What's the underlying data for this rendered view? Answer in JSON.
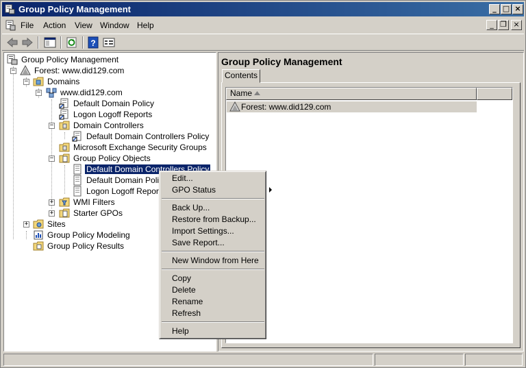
{
  "window": {
    "title": "Group Policy Management"
  },
  "menubar": {
    "items": [
      "File",
      "Action",
      "View",
      "Window",
      "Help"
    ]
  },
  "toolbar": {
    "buttons": [
      "back-icon",
      "forward-icon",
      "show-hide-tree-icon",
      "refresh-icon",
      "help-icon",
      "properties-icon"
    ]
  },
  "tree": {
    "root": "Group Policy Management",
    "forest": "Forest: www.did129.com",
    "domains": "Domains",
    "domain": "www.did129.com",
    "default_domain_policy": "Default Domain Policy",
    "logon_logoff_reports": "Logon Logoff Reports",
    "domain_controllers": "Domain Controllers",
    "default_dc_policy": "Default Domain Controllers Policy",
    "ms_exchange": "Microsoft Exchange Security Groups",
    "gpo": "Group Policy Objects",
    "gpo_dc_policy": "Default Domain Controllers Policy",
    "gpo_domain_policy": "Default Domain Policy",
    "gpo_logon_reports": "Logon Logoff Reports",
    "wmi_filters": "WMI Filters",
    "starter_gpos": "Starter GPOs",
    "sites": "Sites",
    "gp_modeling": "Group Policy Modeling",
    "gp_results": "Group Policy Results"
  },
  "right_pane": {
    "title": "Group Policy Management",
    "tab": "Contents",
    "column": "Name",
    "rows": [
      "Forest: www.did129.com"
    ]
  },
  "context_menu": {
    "edit": "Edit...",
    "gpo_status": "GPO Status",
    "back_up": "Back Up...",
    "restore": "Restore from Backup...",
    "import": "Import Settings...",
    "save_report": "Save Report...",
    "new_window": "New Window from Here",
    "copy": "Copy",
    "delete": "Delete",
    "rename": "Rename",
    "refresh": "Refresh",
    "help": "Help"
  }
}
